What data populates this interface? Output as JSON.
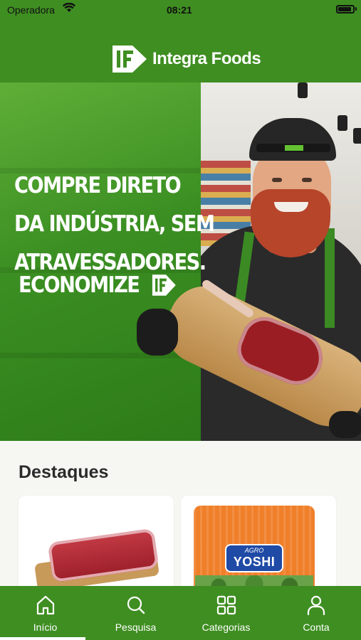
{
  "status_bar": {
    "carrier": "Operadora",
    "time": "08:21"
  },
  "header": {
    "app_name": "Integra Foods",
    "logo_icon": "integra-foods-logo-icon"
  },
  "hero": {
    "lines": [
      "COMPRE DIRETO",
      "DA INDÚSTRIA, SEM",
      "ATRAVESSADORES."
    ],
    "cta": "ECONOMIZE"
  },
  "featured": {
    "title": "Destaques",
    "products": [
      {
        "image": "beef-cut"
      },
      {
        "image": "broccoli-bag",
        "brand_top": "AGRO",
        "brand": "YOSHI"
      }
    ]
  },
  "tabbar": {
    "tabs": [
      {
        "label": "Início",
        "icon": "home-icon",
        "active": true
      },
      {
        "label": "Pesquisa",
        "icon": "search-icon",
        "active": false
      },
      {
        "label": "Categorias",
        "icon": "grid-icon",
        "active": false
      },
      {
        "label": "Conta",
        "icon": "user-icon",
        "active": false
      }
    ]
  },
  "colors": {
    "brand_green": "#3f8e22",
    "background": "#f6f7f2",
    "title_text": "#2b2b2b"
  }
}
